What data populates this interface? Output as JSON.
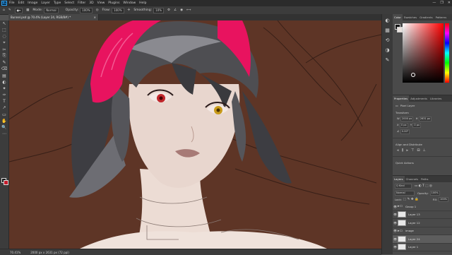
{
  "menubar": {
    "logo": "Ps",
    "items": [
      "File",
      "Edit",
      "Image",
      "Layer",
      "Type",
      "Select",
      "Filter",
      "3D",
      "View",
      "Plugins",
      "Window",
      "Help"
    ],
    "window_controls": [
      "—",
      "❐",
      "✕"
    ]
  },
  "options_bar": {
    "mode_label": "Mode:",
    "mode_value": "Normal",
    "opacity_label": "Opacity:",
    "opacity_value": "100%",
    "flow_label": "Flow:",
    "flow_value": "100%",
    "smoothing_label": "Smoothing:",
    "smoothing_value": "10%"
  },
  "document": {
    "tab_title": "Bunnel.psd @ 70.4% (Layer 24, RGB/8#) *",
    "status_zoom": "70.41%",
    "status_info": "2000 px x 2631 px (72 ppi)"
  },
  "tools": [
    "↖",
    "⬚",
    "◌",
    "⌖",
    "✂",
    "⎘",
    "✎",
    "⌫",
    "▤",
    "◐",
    "✦",
    "✑",
    "T",
    "↗",
    "▭",
    "✋",
    "🔍",
    "⋯"
  ],
  "right_strip_icons": [
    "color-icon",
    "swatch-icon",
    "history-icon",
    "properties-icon",
    "layers-icon"
  ],
  "color_panel": {
    "tabs": [
      "Color",
      "Swatches",
      "Gradients",
      "Patterns"
    ]
  },
  "properties_panel": {
    "tabs": [
      "Properties",
      "Adjustments",
      "Libraries"
    ],
    "layer_kind": "Pixel Layer",
    "transform_title": "Transform",
    "w_label": "W",
    "w_value": "2000 px",
    "h_label": "H",
    "h_value": "2631 px",
    "x_label": "X",
    "x_value": "0 px",
    "y_label": "Y",
    "y_value": "0 px",
    "angle_value": "0.00°",
    "align_title": "Align and Distribute",
    "quick_actions_title": "Quick Actions"
  },
  "layers_panel": {
    "tabs": [
      "Layers",
      "Channels",
      "Paths"
    ],
    "kind_label": "Q Kind",
    "blend_mode": "Normal",
    "opacity_label": "Opacity:",
    "opacity_value": "100%",
    "lock_label": "Lock:",
    "fill_label": "Fill:",
    "fill_value": "100%",
    "layers": [
      {
        "name": "Group 1",
        "type": "group",
        "selected": false
      },
      {
        "name": "Layer 13",
        "type": "layer",
        "selected": false
      },
      {
        "name": "Layer 12",
        "type": "layer",
        "selected": false
      },
      {
        "name": "image",
        "type": "group",
        "selected": false
      },
      {
        "name": "Layer 24",
        "type": "layer",
        "selected": true
      },
      {
        "name": "Layer 1",
        "type": "layer",
        "selected": false
      }
    ]
  },
  "colors": {
    "canvas_bg": "#5e3526",
    "headband": "#e8135f",
    "hair": "#4e4e52",
    "skin": "#e8d6ce",
    "eye_left": "#c0262b",
    "eye_right": "#c89a1a"
  }
}
